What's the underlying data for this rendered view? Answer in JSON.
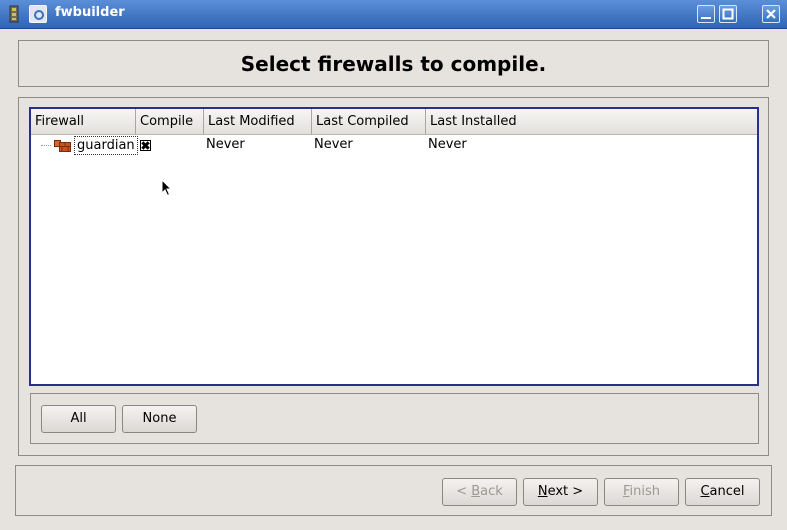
{
  "window": {
    "title": "fwbuilder",
    "icons": [
      "app-icon",
      "window-menu-icon",
      "minimize-icon",
      "maximize-icon",
      "close-icon"
    ],
    "accent_color": "#2f64b6"
  },
  "header": {
    "title": "Select firewalls to compile."
  },
  "table": {
    "columns": [
      "Firewall",
      "Compile",
      "Last Modified",
      "Last Compiled",
      "Last Installed"
    ],
    "rows": [
      {
        "icon": "firewall-icon",
        "firewall": "guardian",
        "compile_checked": true,
        "last_modified": "Never",
        "last_compiled": "Never",
        "last_installed": "Never"
      }
    ]
  },
  "selection_buttons": {
    "all": "All",
    "none": "None"
  },
  "wizard": {
    "back": {
      "mnemonic": "B",
      "rest": "ack",
      "prefix": "< ",
      "enabled": false
    },
    "next": {
      "mnemonic": "N",
      "rest": "ext",
      "suffix": " >",
      "enabled": true
    },
    "finish": {
      "mnemonic": "F",
      "rest": "inish",
      "enabled": false
    },
    "cancel": {
      "mnemonic": "C",
      "rest": "ancel",
      "enabled": true
    }
  }
}
